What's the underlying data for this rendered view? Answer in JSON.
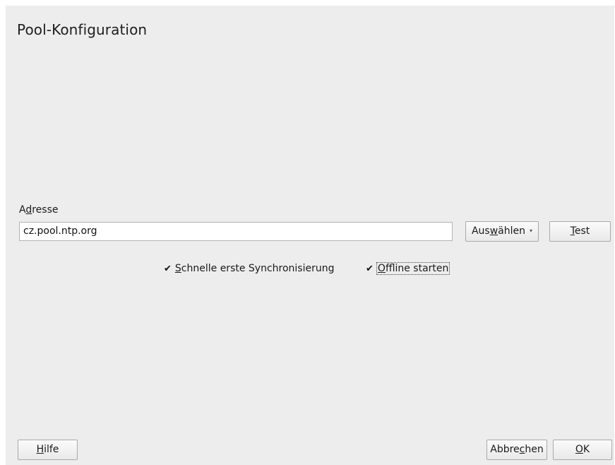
{
  "dialog": {
    "title": "Pool-Konfiguration",
    "status_icon": "moon-icon"
  },
  "address": {
    "label_pre": "A",
    "label_key": "d",
    "label_post": "resse",
    "value": "cz.pool.ntp.org"
  },
  "buttons": {
    "select": {
      "pre": "Aus",
      "key": "w",
      "post": "ählen",
      "arrow": "▾"
    },
    "test": {
      "pre": "",
      "key": "T",
      "post": "est"
    },
    "help": {
      "pre": "",
      "key": "H",
      "post": "ilfe"
    },
    "cancel": {
      "pre": "Abbre",
      "key": "c",
      "post": "hen"
    },
    "ok": {
      "pre": "",
      "key": "O",
      "post": "K"
    }
  },
  "checkboxes": {
    "quick_sync": {
      "checked": true,
      "mark": "✔",
      "pre": "",
      "key": "S",
      "post": "chnelle erste Synchronisierung"
    },
    "offline_start": {
      "checked": true,
      "mark": "✔",
      "pre": "",
      "key": "O",
      "post": "ffline starten"
    }
  }
}
